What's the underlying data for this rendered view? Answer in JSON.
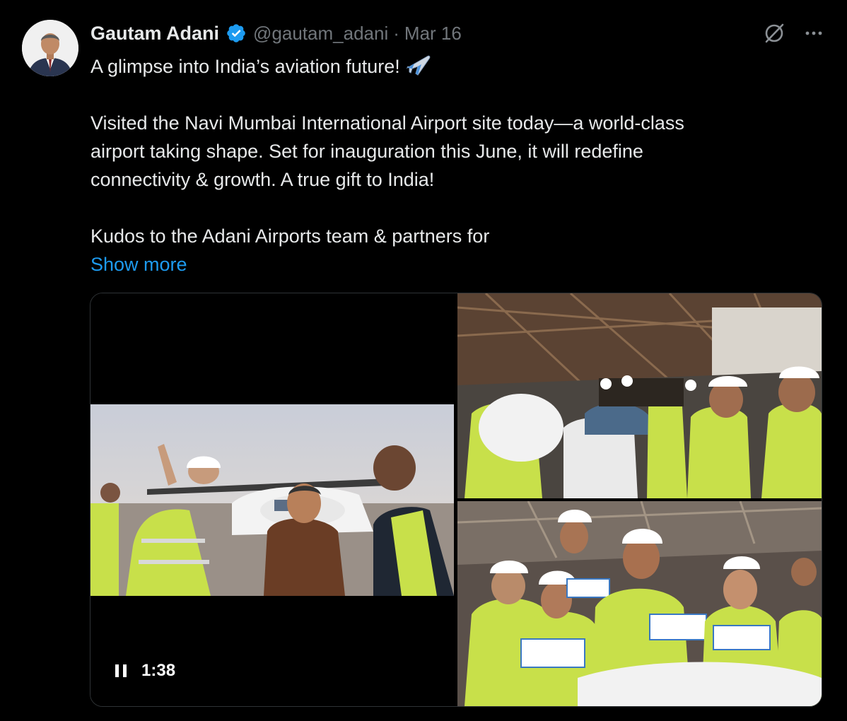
{
  "tweet": {
    "author_name": "Gautam Adani",
    "handle": "@gautam_adani",
    "separator": "·",
    "date": "Mar 16",
    "line1": "A glimpse into India’s aviation future!",
    "para2": "Visited the Navi Mumbai International Airport site today—a world-class\nairport taking shape. Set for inauguration this June, it will redefine\nconnectivity & growth. A true gift to India!",
    "para3": "Kudos to the Adani Airports team & partners for",
    "show_more": "Show more"
  },
  "icons": {
    "verified": "verified-badge-icon",
    "grok": "grok-icon",
    "more": "more-icon",
    "plane": "airplane-emoji-icon",
    "pause": "pause-icon"
  },
  "media": {
    "video_duration": "1:38"
  },
  "colors": {
    "background": "#000000",
    "text": "#e7e9ea",
    "muted": "#71767b",
    "accent": "#1d9bf0",
    "border": "#2f3336"
  }
}
